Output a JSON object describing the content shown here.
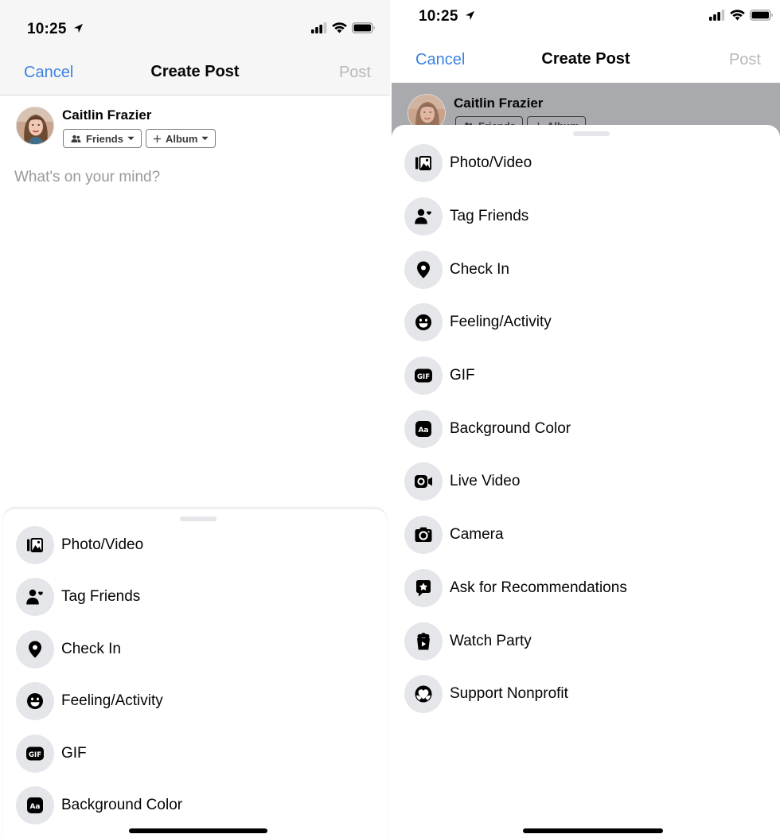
{
  "statusbar": {
    "time": "10:25"
  },
  "navbar": {
    "cancel": "Cancel",
    "title": "Create Post",
    "post": "Post"
  },
  "composer": {
    "user_name": "Caitlin Frazier",
    "audience_chip": "Friends",
    "album_chip": "Album",
    "placeholder": "What's on your mind?"
  },
  "sheet_left": {
    "items": [
      {
        "label": "Photo/Video",
        "icon": "photo-icon"
      },
      {
        "label": "Tag Friends",
        "icon": "tag-friends-icon"
      },
      {
        "label": "Check In",
        "icon": "location-pin-icon"
      },
      {
        "label": "Feeling/Activity",
        "icon": "smiley-icon"
      },
      {
        "label": "GIF",
        "icon": "gif-icon"
      },
      {
        "label": "Background Color",
        "icon": "text-background-icon"
      }
    ]
  },
  "sheet_right": {
    "items": [
      {
        "label": "Photo/Video",
        "icon": "photo-icon"
      },
      {
        "label": "Tag Friends",
        "icon": "tag-friends-icon"
      },
      {
        "label": "Check In",
        "icon": "location-pin-icon"
      },
      {
        "label": "Feeling/Activity",
        "icon": "smiley-icon"
      },
      {
        "label": "GIF",
        "icon": "gif-icon"
      },
      {
        "label": "Background Color",
        "icon": "text-background-icon"
      },
      {
        "label": "Live Video",
        "icon": "live-video-icon"
      },
      {
        "label": "Camera",
        "icon": "camera-icon"
      },
      {
        "label": "Ask for Recommendations",
        "icon": "recommendation-icon"
      },
      {
        "label": "Watch Party",
        "icon": "watch-party-icon"
      },
      {
        "label": "Support Nonprofit",
        "icon": "nonprofit-heart-icon"
      }
    ]
  },
  "colors": {
    "link_blue": "#3b82e0",
    "disabled_gray": "#b8b8bc",
    "icon_bg": "#e4e6ea"
  }
}
